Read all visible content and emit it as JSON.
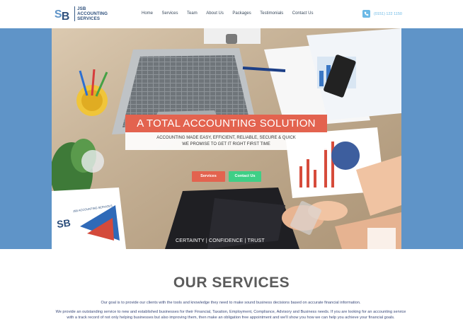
{
  "logo": {
    "line1": "JSB",
    "line2": "ACCOUNTING",
    "line3": "SERVICES"
  },
  "nav": [
    "Home",
    "Services",
    "Team",
    "About Us",
    "Packages",
    "Testimonials",
    "Contact Us"
  ],
  "phone": {
    "number": "(0151) 122 1150"
  },
  "hero": {
    "title": "A TOTAL ACCOUNTING SOLUTION",
    "subtitle_line1": "ACCOUNTING MADE EASY, EFFICIENT, RELIABLE, SECURE & QUICK",
    "subtitle_line2": "WE PROMISE TO GET IT RIGHT FIRST TIME",
    "services_button": "Services",
    "contact_button": "Contact Us",
    "tagline": "CERTAINTY | CONFIDENCE | TRUST",
    "card_text": "JSB ACCOUNTING SERVICES"
  },
  "services": {
    "title": "OUR SERVICES",
    "paragraph1": "Our goal is to provide our clients with the tools and knowledge they need to make sound business decisions based on accurate financial information.",
    "paragraph2": "We provide an outstanding service to new and established businesses for their Financial, Taxation, Employment, Compliance, Advisory and Business needs. If you are looking for an accounting service with a track record of not only helping businesses but also improving them, then make an obligation free appointment and we'll show you how we can help you achieve your financial goals."
  },
  "colors": {
    "brand_blue": "#2d4f7c",
    "band_blue": "#5f94c8",
    "accent_red": "#e3634f",
    "accent_green": "#3fcf86",
    "phone_blue": "#6cb9e6"
  }
}
